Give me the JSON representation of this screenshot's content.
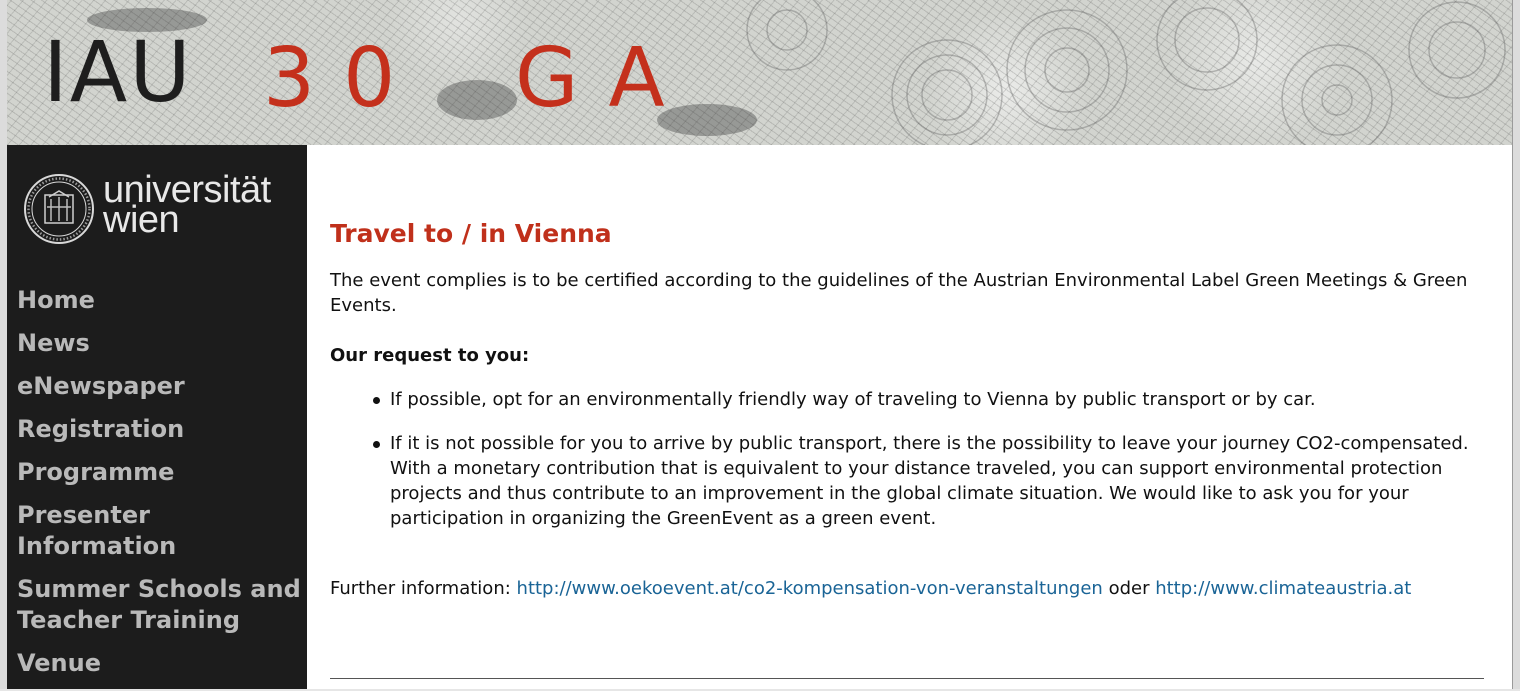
{
  "banner": {
    "title_iau": "IAU",
    "title_number": "30",
    "title_ga": "GA"
  },
  "sidebar": {
    "logo": {
      "word_line1": "universität",
      "word_line2": "wien"
    },
    "nav": [
      {
        "label": "Home"
      },
      {
        "label": "News"
      },
      {
        "label": "eNewspaper"
      },
      {
        "label": "Registration"
      },
      {
        "label": "Programme"
      },
      {
        "label": "Presenter Information"
      },
      {
        "label": "Summer Schools and Teacher Training"
      },
      {
        "label": "Venue"
      }
    ]
  },
  "main": {
    "title": "Travel to / in Vienna",
    "intro": "The event complies is to be certified according to the guidelines of the Austrian Environmental Label Green Meetings & Green Events.",
    "request_heading": "Our request to you:",
    "bullets": [
      "If possible, opt for an environmentally friendly way of traveling to Vienna by public transport or by car.",
      "If it is not possible for you to arrive by public transport, there is the possibility to leave your journey CO2-compensated. With a monetary contribution that is equivalent to your distance traveled, you can support environmental protection projects and thus contribute to an improvement in the global climate situation. We would like to ask you for your participation in organizing the GreenEvent as a green event."
    ],
    "further_label": "Further information:",
    "link1": "http://www.oekoevent.at/co2-kompensation-von-veranstaltungen",
    "connector": "oder",
    "link2": "http://www.climateaustria.at"
  },
  "colors": {
    "accent": "#c0301b",
    "link": "#1a6496",
    "sidebar_bg": "#1c1c1c",
    "nav_text": "#b9b9b9"
  }
}
